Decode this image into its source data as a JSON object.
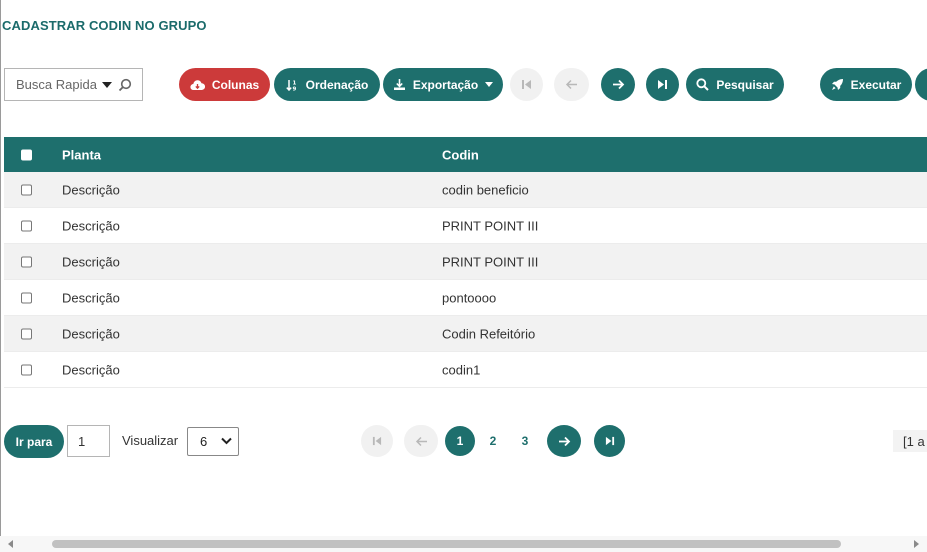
{
  "page": {
    "title": "CADASTRAR CODIN NO GRUPO"
  },
  "toolbar": {
    "search_placeholder": "Busca Rapida",
    "columns_label": "Colunas",
    "ordering_label": "Ordenação",
    "export_label": "Exportação",
    "search_button_label": "Pesquisar",
    "execute_label": "Executar",
    "colors": {
      "primary": "#1e6f6d",
      "danger": "#cc3a3a",
      "disabled": "#f1f1f1"
    }
  },
  "table": {
    "headers": {
      "planta": "Planta",
      "codin": "Codin"
    },
    "rows": [
      {
        "planta": "Descrição",
        "codin": "codin beneficio"
      },
      {
        "planta": "Descrição",
        "codin": "PRINT POINT III"
      },
      {
        "planta": "Descrição",
        "codin": "PRINT POINT III"
      },
      {
        "planta": "Descrição",
        "codin": "pontoooo"
      },
      {
        "planta": "Descrição",
        "codin": "Codin Refeitório"
      },
      {
        "planta": "Descrição",
        "codin": "codin1"
      }
    ]
  },
  "pagination": {
    "goto_label": "Ir para",
    "goto_value": "1",
    "view_label": "Visualizar",
    "page_size": "6",
    "pages": [
      "1",
      "2",
      "3"
    ],
    "current_page": "1",
    "range_text": "[1 a"
  }
}
